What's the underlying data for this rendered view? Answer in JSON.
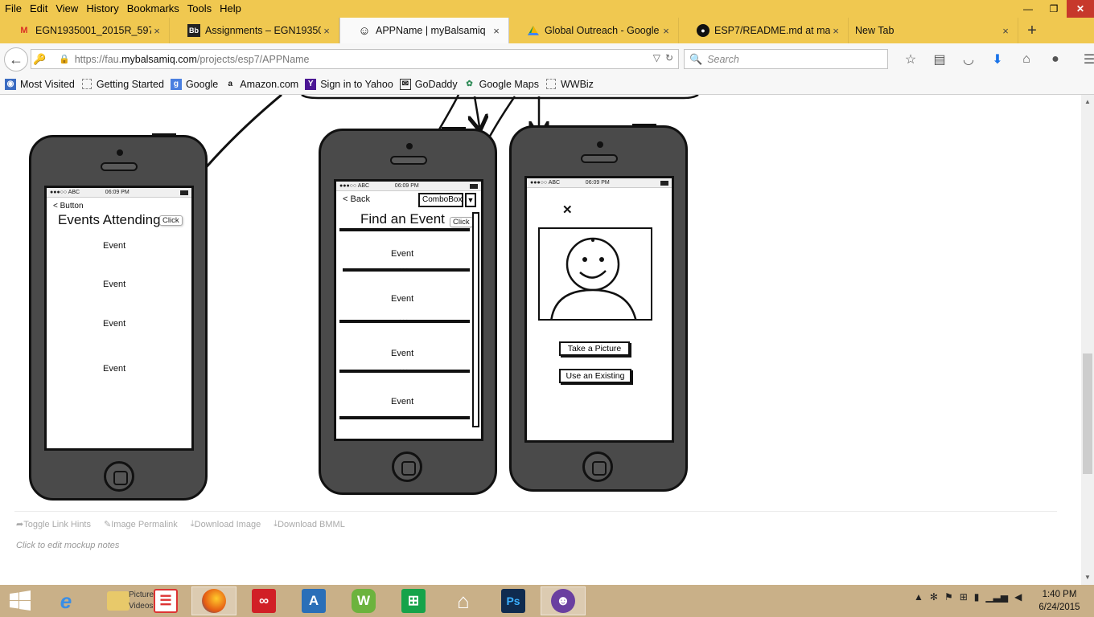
{
  "menu": [
    "File",
    "Edit",
    "View",
    "History",
    "Bookmarks",
    "Tools",
    "Help"
  ],
  "window_controls": {
    "minimize": "—",
    "restore": "❐",
    "close": "✕"
  },
  "tabs": [
    {
      "label": "EGN1935001_2015R_59742 (...",
      "icon": "gmail-icon",
      "active": false
    },
    {
      "label": "Assignments – EGN193500...",
      "icon": "blackboard-icon",
      "active": false
    },
    {
      "label": "APPName | myBalsamiq",
      "icon": "smiley-icon",
      "active": true
    },
    {
      "label": "Global Outreach - Google ...",
      "icon": "google-drive-icon",
      "active": false
    },
    {
      "label": "ESP7/README.md at mast...",
      "icon": "github-icon",
      "active": false
    },
    {
      "label": "New Tab",
      "icon": "",
      "active": false
    }
  ],
  "tab_close": "×",
  "newtab": "+",
  "url": {
    "prefix": "https://fau.",
    "host": "mybalsamiq.com",
    "path": "/projects/esp7/APPName"
  },
  "search": {
    "placeholder": "Search"
  },
  "bookmarks": [
    {
      "label": "Most Visited",
      "icon": "most-visited-icon"
    },
    {
      "label": "Getting Started",
      "icon": "bookmark-folder-icon"
    },
    {
      "label": "Google",
      "icon": "google-icon"
    },
    {
      "label": "Amazon.com",
      "icon": "amazon-icon"
    },
    {
      "label": "Sign in to Yahoo",
      "icon": "yahoo-icon"
    },
    {
      "label": "GoDaddy",
      "icon": "godaddy-icon"
    },
    {
      "label": "Google Maps",
      "icon": "google-maps-icon"
    },
    {
      "label": "WWBiz",
      "icon": "bookmark-folder-icon"
    }
  ],
  "mockup": {
    "phone1": {
      "carrier": "●●●○○ ABC",
      "time": "06:09 PM",
      "back_label": "Button",
      "title": "Events Attending",
      "click": "Click",
      "events": [
        "Event",
        "Event",
        "Event",
        "Event"
      ]
    },
    "phone2": {
      "carrier": "●●●○○ ABC",
      "time": "06:09 PM",
      "back_label": "Back",
      "combo": "ComboBox",
      "combo_arrow": "▼",
      "title": "Find an Event",
      "click": "Click",
      "dots": "•••",
      "events": [
        "Event",
        "Event",
        "Event",
        "Event"
      ]
    },
    "phone3": {
      "carrier": "●●●○○ ABC",
      "time": "06:09 PM",
      "close_mark": "✕",
      "buttons": [
        "Take a Picture",
        "Use an Existing"
      ]
    }
  },
  "footer": {
    "links": [
      "Toggle Link Hints",
      "Image Permalink",
      "Download Image",
      "Download BMML"
    ],
    "note": "Click to edit mockup notes"
  },
  "taskbar": {
    "explorer_label": "Pictures\nVideos",
    "time": "1:40 PM",
    "date": "6/24/2015"
  }
}
